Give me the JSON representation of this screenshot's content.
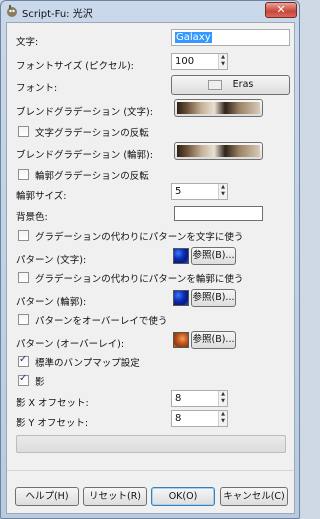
{
  "window": {
    "title": "Script-Fu: 光沢",
    "close_label": "✕"
  },
  "text": {
    "label": "文字:",
    "value": "Galaxy"
  },
  "font_size": {
    "label": "フォントサイズ (ピクセル):",
    "value": "100"
  },
  "font": {
    "label": "フォント:",
    "value": "Eras"
  },
  "blend_text": {
    "label": "ブレンドグラデーション (文字):"
  },
  "reverse_text": {
    "label": "文字グラデーションの反転",
    "checked": false
  },
  "blend_outline": {
    "label": "ブレンドグラデーション (輪郭):"
  },
  "reverse_outline": {
    "label": "輪郭グラデーションの反転",
    "checked": false
  },
  "outline_size": {
    "label": "輪郭サイズ:",
    "value": "5"
  },
  "background": {
    "label": "背景色:",
    "color": "#ffffff"
  },
  "pattern_text_toggle": {
    "label": "グラデーションの代わりにパターンを文字に使う",
    "checked": false
  },
  "pattern_text": {
    "label": "パターン (文字):",
    "button": "参照(B)..."
  },
  "pattern_outline_toggle": {
    "label": "グラデーションの代わりにパターンを輪郭に使う",
    "checked": false
  },
  "pattern_outline": {
    "label": "パターン (輪郭):",
    "button": "参照(B)..."
  },
  "pattern_overlay_toggle": {
    "label": "パターンをオーバーレイで使う",
    "checked": false
  },
  "pattern_overlay": {
    "label": "パターン (オーバーレイ):",
    "button": "参照(B)..."
  },
  "default_bumpmap": {
    "label": "標準のバンプマップ設定",
    "checked": true
  },
  "shadow": {
    "label": "影",
    "checked": true
  },
  "shadow_x": {
    "label": "影 X オフセット:",
    "value": "8"
  },
  "shadow_y": {
    "label": "影 Y オフセット:",
    "value": "8"
  },
  "buttons": {
    "help": "ヘルプ(H)",
    "reset": "リセット(R)",
    "ok": "OK(O)",
    "cancel": "キャンセル(C)"
  }
}
